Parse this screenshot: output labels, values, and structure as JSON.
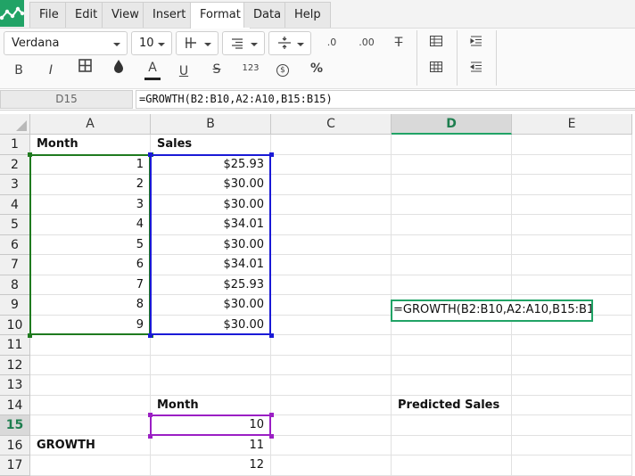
{
  "menu": {
    "items": [
      {
        "label": "File",
        "active": false
      },
      {
        "label": "Edit",
        "active": false
      },
      {
        "label": "View",
        "active": false
      },
      {
        "label": "Insert",
        "active": false
      },
      {
        "label": "Format",
        "active": true
      },
      {
        "label": "Data",
        "active": false
      },
      {
        "label": "Help",
        "active": false
      }
    ]
  },
  "toolbar": {
    "font_name": "Verdana",
    "font_size": "10",
    "bold_label": "B",
    "italic_label": "I",
    "text_color_label": "A",
    "underline_label": "U",
    "strike_label": "S",
    "number_format_label": "123",
    "currency_label": "$",
    "percent_label": "%",
    "decrease_decimal_label": ".0",
    "increase_decimal_label": ".00",
    "clear_format_label": "T"
  },
  "formula_bar": {
    "cell_ref": "D15",
    "formula": "=GROWTH(B2:B10,A2:A10,B15:B15)"
  },
  "sheet": {
    "columns": [
      "A",
      "B",
      "C",
      "D",
      "E"
    ],
    "selected_column": "D",
    "rows": [
      "1",
      "2",
      "3",
      "4",
      "5",
      "6",
      "7",
      "8",
      "9",
      "10",
      "11",
      "12",
      "13",
      "14",
      "15",
      "16",
      "17"
    ],
    "selected_row": "15",
    "cells": {
      "A1": "Month",
      "B1": "Sales",
      "A2": "1",
      "B2": "$25.93",
      "A3": "2",
      "B3": "$30.00",
      "A4": "3",
      "B4": "$30.00",
      "A5": "4",
      "B5": "$34.01",
      "A6": "5",
      "B6": "$30.00",
      "A7": "6",
      "B7": "$34.01",
      "A8": "7",
      "B8": "$25.93",
      "A9": "8",
      "B9": "$30.00",
      "A10": "9",
      "B10": "$30.00",
      "B14": "Month",
      "D14": "Predicted Sales",
      "B15": "10",
      "A16": "GROWTH",
      "B16": "11",
      "B17": "12"
    },
    "editing_text": "=GROWTH(B2:B10,A2:A10,B15:B15)"
  },
  "colors": {
    "accent": "#21a366",
    "range_a": "#1f7a1f",
    "range_b": "#1a1ad6",
    "range_c": "#9b1fc4"
  }
}
